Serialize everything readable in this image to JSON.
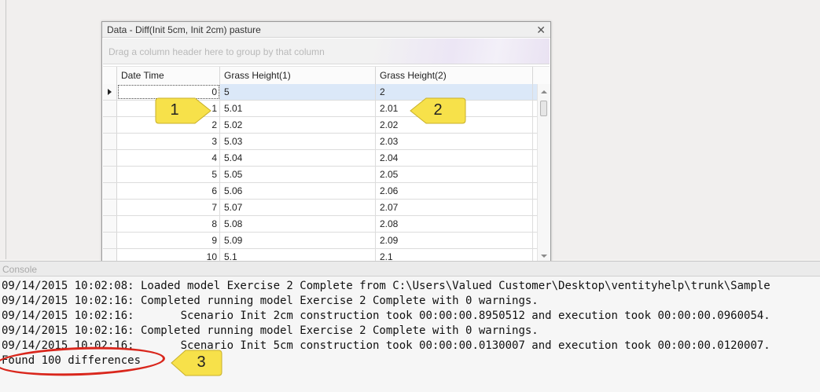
{
  "data_window": {
    "title": "Data - Diff(Init 5cm, Init 2cm) pasture",
    "close_glyph": "✕",
    "group_panel_text": "Drag a column header here to group by that column",
    "columns": [
      "Date Time",
      "Grass Height(1)",
      "Grass Height(2)"
    ],
    "rows": [
      {
        "dt": "0",
        "h1": "5",
        "h2": "2"
      },
      {
        "dt": "1",
        "h1": "5.01",
        "h2": "2.01"
      },
      {
        "dt": "2",
        "h1": "5.02",
        "h2": "2.02"
      },
      {
        "dt": "3",
        "h1": "5.03",
        "h2": "2.03"
      },
      {
        "dt": "4",
        "h1": "5.04",
        "h2": "2.04"
      },
      {
        "dt": "5",
        "h1": "5.05",
        "h2": "2.05"
      },
      {
        "dt": "6",
        "h1": "5.06",
        "h2": "2.06"
      },
      {
        "dt": "7",
        "h1": "5.07",
        "h2": "2.07"
      },
      {
        "dt": "8",
        "h1": "5.08",
        "h2": "2.08"
      },
      {
        "dt": "9",
        "h1": "5.09",
        "h2": "2.09"
      },
      {
        "dt": "10",
        "h1": "5.1",
        "h2": "2.1"
      }
    ],
    "selected_row_index": 0
  },
  "console": {
    "title": "Console",
    "lines": [
      "09/14/2015 10:02:08: Loaded model Exercise 2 Complete from C:\\Users\\Valued Customer\\Desktop\\ventityhelp\\trunk\\Sample",
      "09/14/2015 10:02:16: Completed running model Exercise 2 Complete with 0 warnings.",
      "09/14/2015 10:02:16:       Scenario Init 2cm construction took 00:00:00.8950512 and execution took 00:00:00.0960054.",
      "09/14/2015 10:02:16: Completed running model Exercise 2 Complete with 0 warnings.",
      "09/14/2015 10:02:16:       Scenario Init 5cm construction took 00:00:00.0130007 and execution took 00:00:00.0120007.",
      "Found 100 differences"
    ]
  },
  "callouts": [
    {
      "label": "1"
    },
    {
      "label": "2"
    },
    {
      "label": "3"
    }
  ],
  "colors": {
    "callout_fill": "#f7e14a",
    "callout_stroke": "#c8b02a",
    "highlight_ellipse": "#d9261c",
    "selected_row": "#dbe8f8"
  }
}
